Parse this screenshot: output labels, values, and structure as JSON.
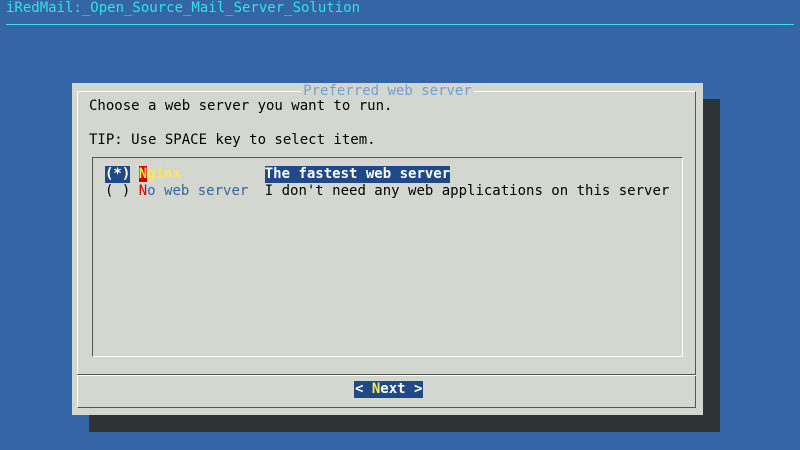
{
  "backtitle": "iRedMail:_Open_Source_Mail_Server_Solution",
  "dialog": {
    "title": "Preferred web server",
    "prompt": "Choose a web server you want to run.",
    "tip": "TIP: Use SPACE key to select item."
  },
  "menu": {
    "items": [
      {
        "mark": "(*)",
        "tag_hot": "N",
        "tag_rest": "ginx",
        "description": "The fastest web server",
        "selected": true
      },
      {
        "mark": "( )",
        "tag_hot": "N",
        "tag_rest": "o web server",
        "description": "I don't need any web applications on this server",
        "selected": false
      }
    ]
  },
  "buttons": {
    "next": {
      "left": "< ",
      "hot": "N",
      "rest": "ext",
      "right": " >"
    }
  },
  "colors": {
    "background": "#3465a4",
    "backtitle": "#34e2e2",
    "dialog": "#d3d7cf",
    "title": "#729fcf",
    "highlight": "#204a87",
    "hotkey_bg": "#cc0000",
    "hotkey_fg": "#fce94f",
    "shadow": "#2e3436"
  }
}
